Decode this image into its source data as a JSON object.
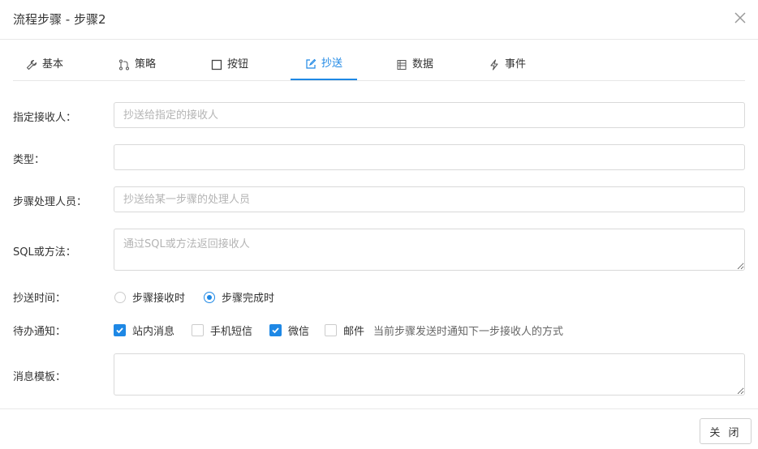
{
  "dialog": {
    "title": "流程步骤 - 步骤2"
  },
  "tabs": [
    {
      "label": "基本",
      "icon": "wrench-icon"
    },
    {
      "label": "策略",
      "icon": "branch-icon"
    },
    {
      "label": "按钮",
      "icon": "square-icon"
    },
    {
      "label": "抄送",
      "icon": "edit-icon",
      "active": true
    },
    {
      "label": "数据",
      "icon": "table-icon"
    },
    {
      "label": "事件",
      "icon": "lightning-icon"
    }
  ],
  "form": {
    "recipient": {
      "label": "指定接收人：",
      "placeholder": "抄送给指定的接收人",
      "value": ""
    },
    "type": {
      "label": "类型：",
      "value": ""
    },
    "step_handler": {
      "label": "步骤处理人员：",
      "placeholder": "抄送给某一步骤的处理人员",
      "value": ""
    },
    "sql_method": {
      "label": "SQL或方法：",
      "placeholder": "通过SQL或方法返回接收人",
      "value": ""
    },
    "cc_time": {
      "label": "抄送时间：",
      "options": [
        {
          "label": "步骤接收时",
          "checked": false
        },
        {
          "label": "步骤完成时",
          "checked": true
        }
      ]
    },
    "todo_notice": {
      "label": "待办通知：",
      "options": [
        {
          "label": "站内消息",
          "checked": true
        },
        {
          "label": "手机短信",
          "checked": false
        },
        {
          "label": "微信",
          "checked": true
        },
        {
          "label": "邮件",
          "checked": false
        }
      ],
      "hint": "当前步骤发送时通知下一步接收人的方式"
    },
    "message_template": {
      "label": "消息模板：",
      "value": ""
    }
  },
  "footer": {
    "close_label": "关 闭"
  },
  "colors": {
    "accent": "#1e88e5",
    "border": "#d9d9d9",
    "placeholder": "#b4b4b4"
  }
}
